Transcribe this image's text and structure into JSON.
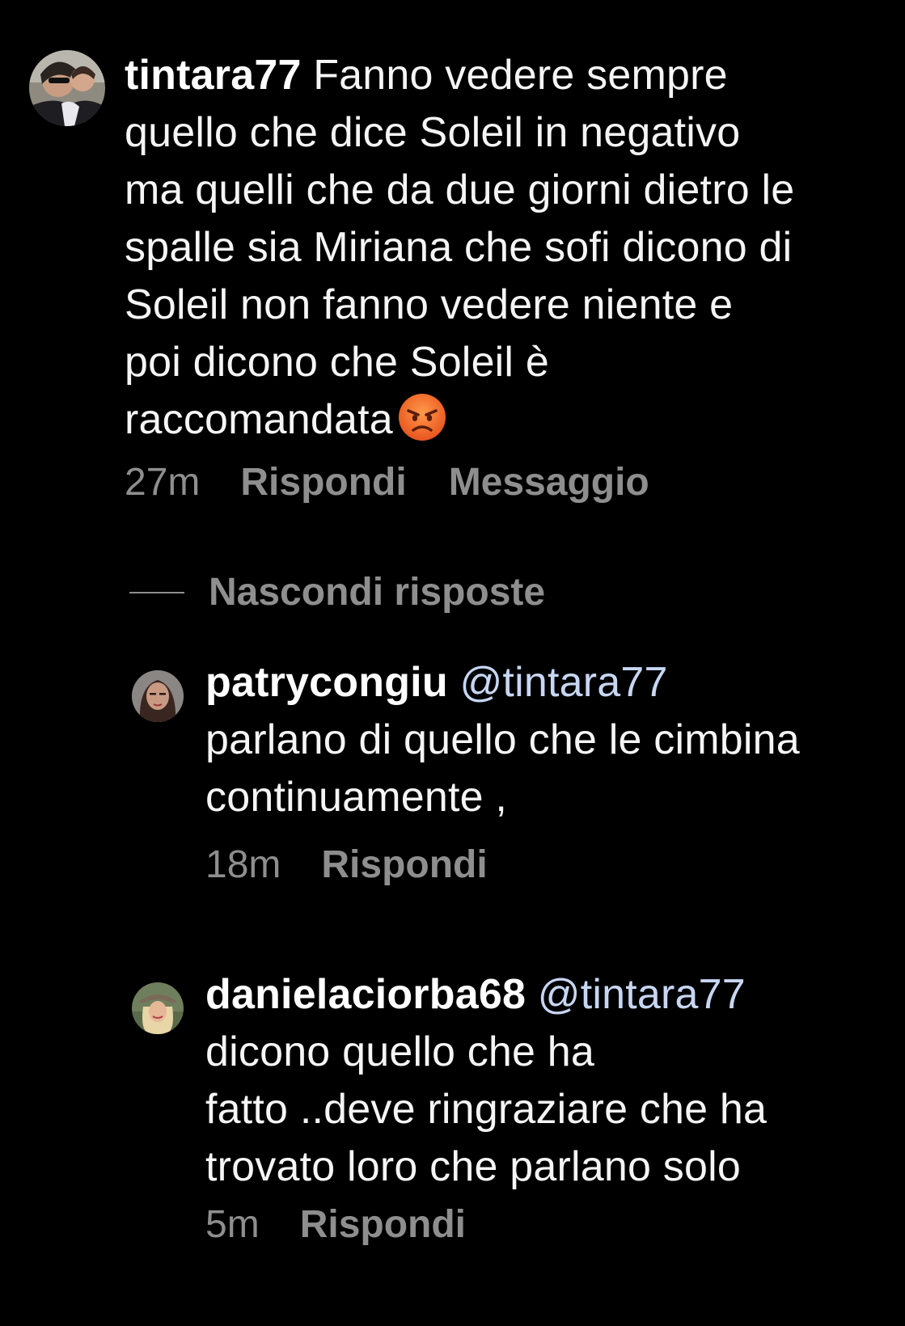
{
  "comments": [
    {
      "username": "tintara77",
      "text_lines": [
        "Fanno vedere sempre",
        "quello che dice Soleil in negativo",
        "ma quelli che da due giorni dietro le",
        "spalle sia Miriana che sofi dicono di",
        "Soleil non fanno vedere niente e",
        "poi dicono che Soleil è",
        "raccomandata"
      ],
      "emoji": "angry-face",
      "time": "27m",
      "reply_label": "Rispondi",
      "message_label": "Messaggio"
    }
  ],
  "hide_replies_label": "Nascondi risposte",
  "replies": [
    {
      "username": "patrycongiu",
      "mention": "@tintara77",
      "text_lines": [
        "parlano di quello che le cimbina",
        "continuamente ,"
      ],
      "time": "18m",
      "reply_label": "Rispondi"
    },
    {
      "username": "danielaciorba68",
      "mention": "@tintara77",
      "text_lines": [
        "dicono quello che ha",
        "fatto ..deve ringraziare che ha",
        "trovato loro che parlano solo"
      ],
      "time": "5m",
      "reply_label": "Rispondi"
    }
  ],
  "colors": {
    "background": "#000000",
    "text": "#f5f5f5",
    "secondary": "#8e8e8e",
    "mention": "#c7d6f2"
  }
}
